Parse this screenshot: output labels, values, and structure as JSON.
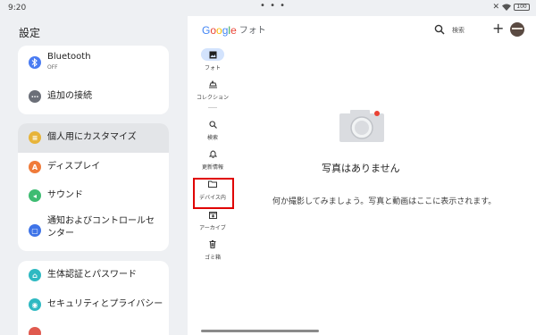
{
  "status_bar": {
    "time": "9:20",
    "battery": "100"
  },
  "settings": {
    "title": "設定",
    "items": [
      {
        "label": "Bluetooth",
        "sub": "OFF",
        "color": "#4a7cf2",
        "icon": "bluetooth-icon"
      },
      {
        "label": "追加の接続",
        "color": "#6b6f78",
        "icon": "more-icon"
      },
      {
        "label": "個人用にカスタマイズ",
        "color": "#e7b43a",
        "icon": "palette-icon",
        "selected": true
      },
      {
        "label": "ディスプレイ",
        "color": "#f07b3a",
        "icon": "display-icon"
      },
      {
        "label": "サウンド",
        "color": "#3ebc72",
        "icon": "sound-icon"
      },
      {
        "label": "通知およびコントロールセンター",
        "color": "#3f74e8",
        "icon": "notification-icon"
      },
      {
        "label": "生体認証とパスワード",
        "color": "#2fb9c2",
        "icon": "lock-icon"
      },
      {
        "label": "セキュリティとプライバシー",
        "color": "#2fb9c2",
        "icon": "shield-icon"
      }
    ]
  },
  "photos": {
    "logo_google": "Google",
    "logo_photos": "フォト",
    "search_label": "検索",
    "nav": [
      {
        "label": "フォト",
        "icon": "photo-icon",
        "active": true
      },
      {
        "label": "コレクション",
        "icon": "collection-icon"
      },
      {
        "label": "検索",
        "icon": "search-icon"
      },
      {
        "label": "更新情報",
        "icon": "bell-icon"
      },
      {
        "label": "デバイス内",
        "icon": "folder-icon"
      },
      {
        "label": "アーカイブ",
        "icon": "archive-icon"
      },
      {
        "label": "ゴミ箱",
        "icon": "trash-icon"
      }
    ],
    "empty_title": "写真はありません",
    "empty_subtitle": "何か撮影してみましょう。写真と動画はここに表示されます。"
  },
  "colors": {
    "accent": "#d3e3fd",
    "highlight": "#e00000",
    "panel_bg": "#eef0f3"
  }
}
